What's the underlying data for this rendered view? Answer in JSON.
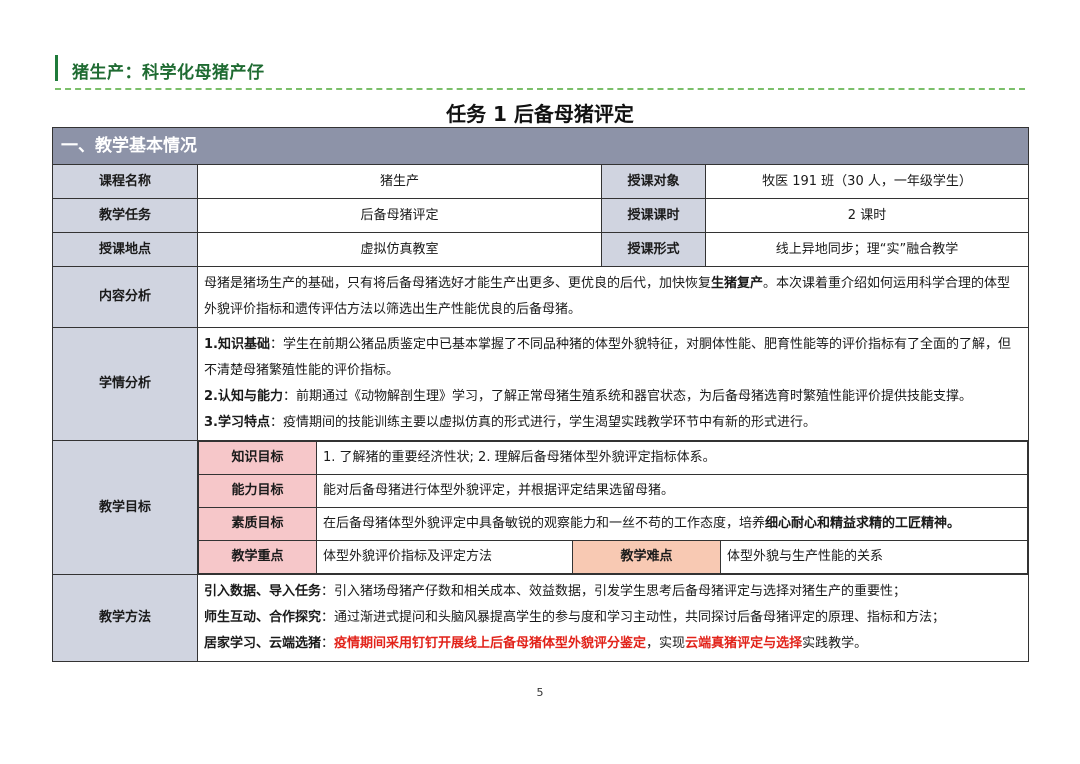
{
  "header": {
    "text": "猪生产：科学化母猪产仔"
  },
  "title": "任务 1  后备母猪评定",
  "section": "一、教学基本情况",
  "basic": {
    "course_label": "课程名称",
    "course_value": "猪生产",
    "target_label": "授课对象",
    "target_value": "牧医 191 班（30 人，一年级学生）",
    "task_label": "教学任务",
    "task_value": "后备母猪评定",
    "hours_label": "授课课时",
    "hours_value": "2 课时",
    "place_label": "授课地点",
    "place_value": "虚拟仿真教室",
    "form_label": "授课形式",
    "form_value": "线上异地同步；理“实”融合教学"
  },
  "content": {
    "label": "内容分析",
    "p1": "母猪是猪场生产的基础，只有将后备母猪选好才能生产出更多、更优良的后代，加快恢复",
    "p1_bold": "生猪复产",
    "p1_end": "。本次课着重介绍如何运用科学合理的体型外貌评价指标和遗传评估方法以筛选出生产性能优良的后备母猪。"
  },
  "learners": {
    "label": "学情分析",
    "l1_head": "1.知识基础",
    "l1_text": "：学生在前期公猪品质鉴定中已基本掌握了不同品种猪的体型外貌特征，对胴体性能、肥育性能等的评价指标有了全面的了解，但不清楚母猪繁殖性能的评价指标。",
    "l2_head": "2.认知与能力",
    "l2_text": "：前期通过《动物解剖生理》学习，了解正常母猪生殖系统和器官状态，为后备母猪选育时繁殖性能评价提供技能支撑。",
    "l3_head": "3.学习特点",
    "l3_text": "：疫情期间的技能训练主要以虚拟仿真的形式进行，学生渴望实践教学环节中有新的形式进行。"
  },
  "goals": {
    "label": "教学目标",
    "knowledge_label": "知识目标",
    "knowledge_text": "1. 了解猪的重要经济性状; 2. 理解后备母猪体型外貌评定指标体系。",
    "ability_label": "能力目标",
    "ability_text": "能对后备母猪进行体型外貌评定，并根据评定结果选留母猪。",
    "quality_label": "素质目标",
    "quality_text": "在后备母猪体型外貌评定中具备敏锐的观察能力和一丝不苟的工作态度，培养",
    "quality_bold": "细心耐心和精益求精的工匠精神。",
    "key_label": "教学重点",
    "key_text": "体型外貌评价指标及评定方法",
    "diff_label": "教学难点",
    "diff_text": "体型外貌与生产性能的关系"
  },
  "methods": {
    "label": "教学方法",
    "m1_head": "引入数据、导入任务",
    "m1_text": "：引入猪场母猪产仔数和相关成本、效益数据，引发学生思考后备母猪评定与选择对猪生产的重要性；",
    "m2_head": "师生互动、合作探究",
    "m2_text": "：通过渐进式提问和头脑风暴提高学生的参与度和学习主动性，共同探讨后备母猪评定的原理、指标和方法；",
    "m3_head": "居家学习、云端选猪",
    "m3_sep": "：",
    "m3_red1": "疫情期间采用钉钉开展线上后备母猪体型外貌评分鉴定",
    "m3_mid": "，实现",
    "m3_red2": "云端真猪评定与选择",
    "m3_end": "实践教学。"
  },
  "colors": {
    "header_green": "#1f6b32",
    "section_bg": "#8d93a8",
    "label_bg": "#d0d4e0",
    "goal_tag": "#f6c7c9",
    "diff_tag": "#f8c9b3",
    "highlight_red": "#e2231a"
  },
  "page_number": "5"
}
